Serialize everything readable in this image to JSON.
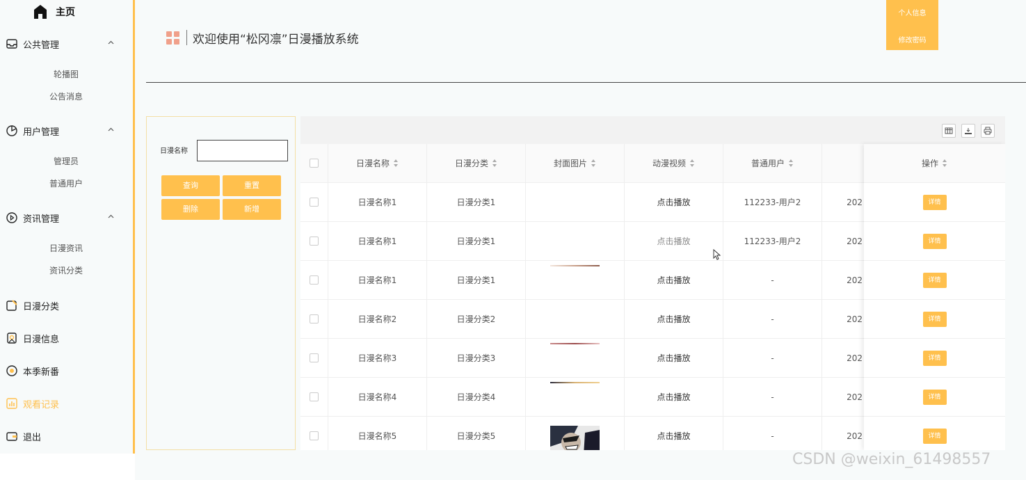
{
  "sidebar": {
    "home_label": "主页",
    "groups": [
      {
        "label": "公共管理",
        "items": [
          "轮播图",
          "公告消息"
        ]
      },
      {
        "label": "用户管理",
        "items": [
          "管理员",
          "普通用户"
        ]
      },
      {
        "label": "资讯管理",
        "items": [
          "日漫资讯",
          "资讯分类"
        ]
      }
    ],
    "singles": [
      "日漫分类",
      "日漫信息",
      "本季新番",
      "观看记录",
      "退出"
    ],
    "active": "观看记录",
    "accent": "#ffc04d"
  },
  "header": {
    "title": "欢迎使用“松冈凛”日漫播放系统",
    "profile_btn": "个人信息",
    "password_btn": "修改密码"
  },
  "search": {
    "label": "日漫名称",
    "value": "",
    "buttons": {
      "query": "查询",
      "reset": "重置",
      "delete": "删除",
      "add": "新增"
    }
  },
  "table": {
    "columns": [
      "日漫名称",
      "日漫分类",
      "封面图片",
      "动漫视频",
      "普通用户",
      "操作"
    ],
    "rows": [
      {
        "name": "日漫名称1",
        "category": "日漫分类1",
        "video": "点击播放",
        "user": "112233-用户2",
        "date": "202",
        "action": "详情"
      },
      {
        "name": "日漫名称1",
        "category": "日漫分类1",
        "video": "点击播放",
        "user": "112233-用户2",
        "date": "202",
        "action": "详情"
      },
      {
        "name": "日漫名称1",
        "category": "日漫分类1",
        "video": "点击播放",
        "user": "-",
        "date": "202",
        "action": "详情"
      },
      {
        "name": "日漫名称2",
        "category": "日漫分类2",
        "video": "点击播放",
        "user": "-",
        "date": "202",
        "action": "详情"
      },
      {
        "name": "日漫名称3",
        "category": "日漫分类3",
        "video": "点击播放",
        "user": "-",
        "date": "202",
        "action": "详情"
      },
      {
        "name": "日漫名称4",
        "category": "日漫分类4",
        "video": "点击播放",
        "user": "-",
        "date": "202",
        "action": "详情"
      },
      {
        "name": "日漫名称5",
        "category": "日漫分类5",
        "video": "点击播放",
        "user": "-",
        "date": "202",
        "action": "详情"
      }
    ]
  },
  "watermark": "CSDN @weixin_61498557"
}
